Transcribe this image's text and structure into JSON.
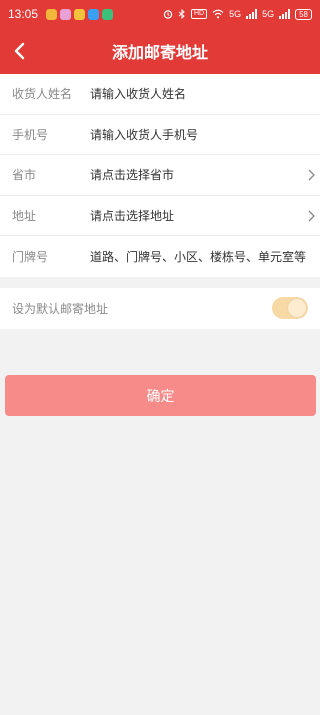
{
  "status_bar": {
    "time": "13:05",
    "net_label": "HD",
    "signal_label_1": "5G",
    "signal_label_2": "5G",
    "battery": "58",
    "app_icon_colors": [
      "#f2b63a",
      "#e8a0d6",
      "#f4c33b",
      "#3aa0f3",
      "#3cc17a"
    ]
  },
  "header": {
    "title": "添加邮寄地址",
    "back_icon": "chevron-left-icon"
  },
  "form": {
    "rows": [
      {
        "label": "收货人姓名",
        "value": "请输入收货人姓名"
      },
      {
        "label": "手机号",
        "value": "请输入收货人手机号"
      },
      {
        "label": "省市",
        "value": "请点击选择省市"
      },
      {
        "label": "地址",
        "value": "请点击选择地址"
      },
      {
        "label": "门牌号",
        "value": "道路、门牌号、小区、楼栋号、单元室等"
      }
    ]
  },
  "default_address": {
    "label": "设为默认邮寄地址",
    "enabled": true
  },
  "confirm": {
    "label": "确定"
  },
  "colors": {
    "brand": "#e13a37",
    "button": "#f68b8a",
    "toggle": "#f7d9a6"
  }
}
